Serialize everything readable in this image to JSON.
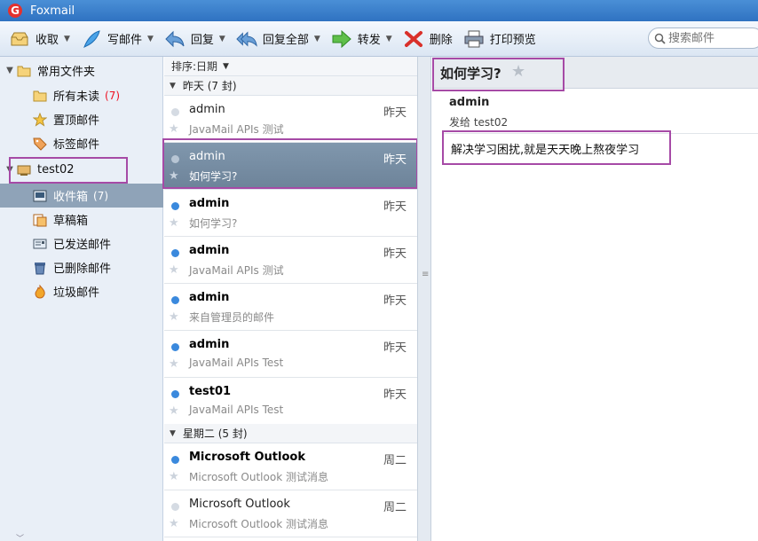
{
  "window": {
    "title": "Foxmail"
  },
  "toolbar": {
    "receive": "收取",
    "compose": "写邮件",
    "reply": "回复",
    "reply_all": "回复全部",
    "forward": "转发",
    "delete": "删除",
    "print_preview": "打印预览",
    "search_placeholder": "搜索邮件"
  },
  "sidebar": {
    "common_folders": "常用文件夹",
    "all_unread": "所有未读",
    "all_unread_count": "(7)",
    "pinned": "置顶邮件",
    "tagged": "标签邮件",
    "account": "test02",
    "inbox": "收件箱",
    "inbox_count": "(7)",
    "drafts": "草稿箱",
    "sent": "已发送邮件",
    "deleted": "已删除邮件",
    "junk": "垃圾邮件"
  },
  "list": {
    "sort_label": "排序:日期",
    "groups": [
      {
        "label": "昨天 (7 封)"
      },
      {
        "label": "星期二 (5 封)"
      }
    ],
    "mails": [
      {
        "from": "admin",
        "date": "昨天",
        "subject": "JavaMail APIs 测试",
        "unread": false
      },
      {
        "from": "admin",
        "date": "昨天",
        "subject": "如何学习?",
        "unread": false
      },
      {
        "from": "admin",
        "date": "昨天",
        "subject": "如何学习?",
        "unread": true
      },
      {
        "from": "admin",
        "date": "昨天",
        "subject": "JavaMail APIs 测试",
        "unread": true
      },
      {
        "from": "admin",
        "date": "昨天",
        "subject": "来自管理员的邮件",
        "unread": true
      },
      {
        "from": "admin",
        "date": "昨天",
        "subject": "JavaMail APIs Test",
        "unread": true
      },
      {
        "from": "test01",
        "date": "昨天",
        "subject": "JavaMail APIs Test",
        "unread": true
      },
      {
        "from": "Microsoft Outlook",
        "date": "周二",
        "subject": "Microsoft Outlook 测试消息",
        "unread": true
      },
      {
        "from": "Microsoft Outlook",
        "date": "周二",
        "subject": "Microsoft Outlook 测试消息",
        "unread": false
      }
    ]
  },
  "reader": {
    "subject": "如何学习?",
    "from": "admin",
    "to": "发给 test02",
    "body": "解决学习困扰,就是天天晚上熬夜学习"
  },
  "colors": {
    "highlight_box": "#a64aa6",
    "unread_dot": "#3a89dd",
    "selected_row": "#8fa3b8"
  }
}
